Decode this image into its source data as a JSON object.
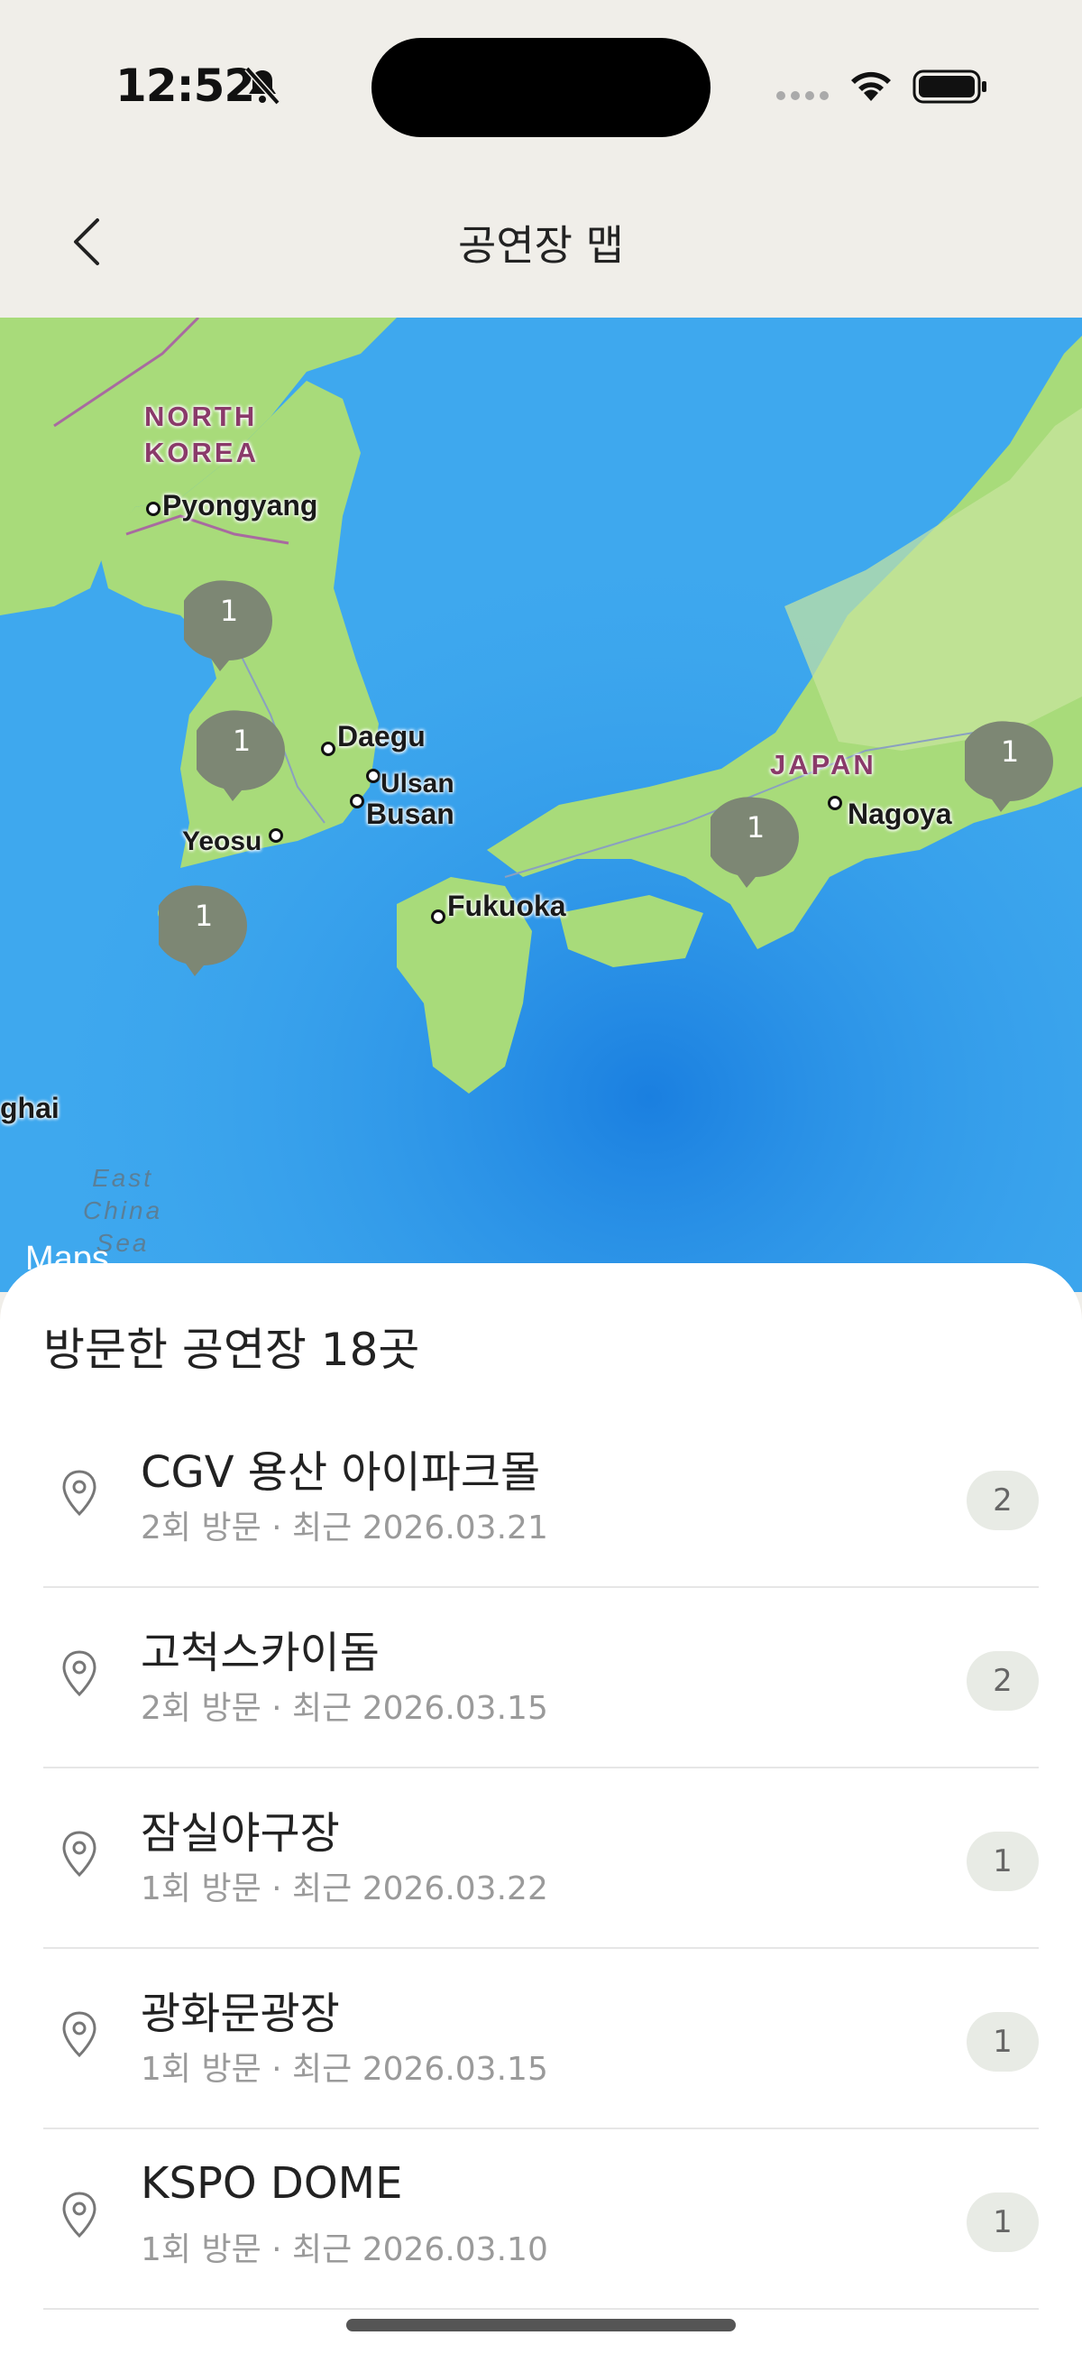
{
  "status_bar": {
    "time": "12:52"
  },
  "nav": {
    "title": "공연장 맵"
  },
  "map": {
    "labels": {
      "north_korea_1": "NORTH",
      "north_korea_2": "KOREA",
      "pyongyang": "Pyongyang",
      "daegu": "Daegu",
      "ulsan": "Ulsan",
      "busan": "Busan",
      "yeosu": "Yeosu",
      "fukuoka": "Fukuoka",
      "japan": "JAPAN",
      "nagoya": "Nagoya",
      "shanghai": "ghai",
      "east_china_sea_1": "East",
      "east_china_sea_2": "China",
      "east_china_sea_3": "Sea",
      "maps_logo": "Maps"
    },
    "pins": [
      {
        "count": "1"
      },
      {
        "count": "1"
      },
      {
        "count": "1"
      },
      {
        "count": "1"
      },
      {
        "count": "1"
      }
    ]
  },
  "sheet": {
    "title": "방문한 공연장 18곳",
    "venues": [
      {
        "name": "CGV 용산 아이파크몰",
        "meta": "2회 방문 · 최근 2026.03.21",
        "count": "2"
      },
      {
        "name": "고척스카이돔",
        "meta": "2회 방문 · 최근 2026.03.15",
        "count": "2"
      },
      {
        "name": "잠실야구장",
        "meta": "1회 방문 · 최근 2026.03.22",
        "count": "1"
      },
      {
        "name": "광화문광장",
        "meta": "1회 방문 · 최근 2026.03.15",
        "count": "1"
      },
      {
        "name": "KSPO DOME",
        "meta": "1회 방문 · 최근 2026.03.10",
        "count": "1"
      }
    ]
  },
  "colors": {
    "background": "#f0eee9",
    "ocean": "#3ea8ee",
    "land": "#a8db7a",
    "pin": "#7d8774",
    "badge": "#e8ebe5"
  }
}
